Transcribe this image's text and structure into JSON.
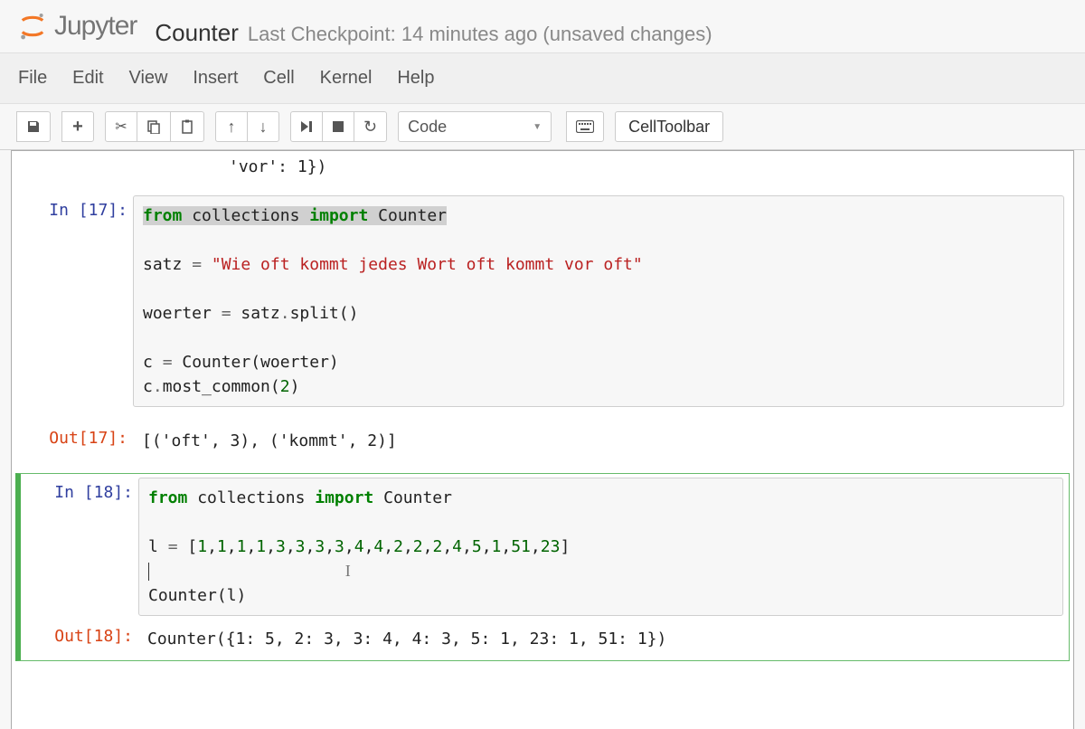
{
  "header": {
    "logo_text": "Jupyter",
    "notebook_name": "Counter",
    "checkpoint": "Last Checkpoint: 14 minutes ago (unsaved changes)"
  },
  "menubar": {
    "items": [
      "File",
      "Edit",
      "View",
      "Insert",
      "Cell",
      "Kernel",
      "Help"
    ]
  },
  "toolbar": {
    "cell_type": "Code",
    "cell_toolbar": "CellToolbar"
  },
  "cells": {
    "fragment_top": "'vor': 1})",
    "cell17": {
      "prompt_in": "In [17]:",
      "prompt_out": "Out[17]:",
      "code_lines": [
        {
          "segments": [
            {
              "t": "from",
              "c": "kw-green",
              "hl": true
            },
            {
              "t": " ",
              "hl": true
            },
            {
              "t": "collections",
              "hl": true
            },
            {
              "t": " ",
              "hl": true
            },
            {
              "t": "import",
              "c": "kw-green",
              "hl": true
            },
            {
              "t": " ",
              "hl": true
            },
            {
              "t": "Counter",
              "hl": true
            }
          ]
        },
        {
          "segments": []
        },
        {
          "segments": [
            {
              "t": "satz "
            },
            {
              "t": "=",
              "c": "op"
            },
            {
              "t": " "
            },
            {
              "t": "\"Wie oft kommt jedes Wort oft kommt vor oft\"",
              "c": "str-red"
            }
          ]
        },
        {
          "segments": []
        },
        {
          "segments": [
            {
              "t": "woerter "
            },
            {
              "t": "=",
              "c": "op"
            },
            {
              "t": " satz"
            },
            {
              "t": ".",
              "c": "op"
            },
            {
              "t": "split()"
            }
          ]
        },
        {
          "segments": []
        },
        {
          "segments": [
            {
              "t": "c "
            },
            {
              "t": "=",
              "c": "op"
            },
            {
              "t": " Counter(woerter)"
            }
          ]
        },
        {
          "segments": [
            {
              "t": "c"
            },
            {
              "t": ".",
              "c": "op"
            },
            {
              "t": "most_common("
            },
            {
              "t": "2",
              "c": "num-green"
            },
            {
              "t": ")"
            }
          ]
        }
      ],
      "output": "[('oft', 3), ('kommt', 2)]"
    },
    "cell18": {
      "prompt_in": "In [18]:",
      "prompt_out": "Out[18]:",
      "code_lines": [
        {
          "segments": [
            {
              "t": "from",
              "c": "kw-green"
            },
            {
              "t": " collections "
            },
            {
              "t": "import",
              "c": "kw-green"
            },
            {
              "t": " Counter"
            }
          ]
        },
        {
          "segments": []
        },
        {
          "segments": [
            {
              "t": "l "
            },
            {
              "t": "=",
              "c": "op"
            },
            {
              "t": " ["
            },
            {
              "t": "1",
              "c": "num-green"
            },
            {
              "t": ","
            },
            {
              "t": "1",
              "c": "num-green"
            },
            {
              "t": ","
            },
            {
              "t": "1",
              "c": "num-green"
            },
            {
              "t": ","
            },
            {
              "t": "1",
              "c": "num-green"
            },
            {
              "t": ","
            },
            {
              "t": "3",
              "c": "num-green"
            },
            {
              "t": ","
            },
            {
              "t": "3",
              "c": "num-green"
            },
            {
              "t": ","
            },
            {
              "t": "3",
              "c": "num-green"
            },
            {
              "t": ","
            },
            {
              "t": "3",
              "c": "num-green"
            },
            {
              "t": ","
            },
            {
              "t": "4",
              "c": "num-green"
            },
            {
              "t": ","
            },
            {
              "t": "4",
              "c": "num-green"
            },
            {
              "t": ","
            },
            {
              "t": "2",
              "c": "num-green"
            },
            {
              "t": ","
            },
            {
              "t": "2",
              "c": "num-green"
            },
            {
              "t": ","
            },
            {
              "t": "2",
              "c": "num-green"
            },
            {
              "t": ","
            },
            {
              "t": "4",
              "c": "num-green"
            },
            {
              "t": ","
            },
            {
              "t": "5",
              "c": "num-green"
            },
            {
              "t": ","
            },
            {
              "t": "1",
              "c": "num-green"
            },
            {
              "t": ","
            },
            {
              "t": "51",
              "c": "num-green"
            },
            {
              "t": ","
            },
            {
              "t": "23",
              "c": "num-green"
            },
            {
              "t": "]"
            }
          ]
        },
        {
          "segments": [],
          "caret": true
        },
        {
          "segments": [
            {
              "t": "Counter(l)"
            }
          ]
        }
      ],
      "output": "Counter({1: 5, 2: 3, 3: 4, 4: 3, 5: 1, 23: 1, 51: 1})"
    }
  }
}
